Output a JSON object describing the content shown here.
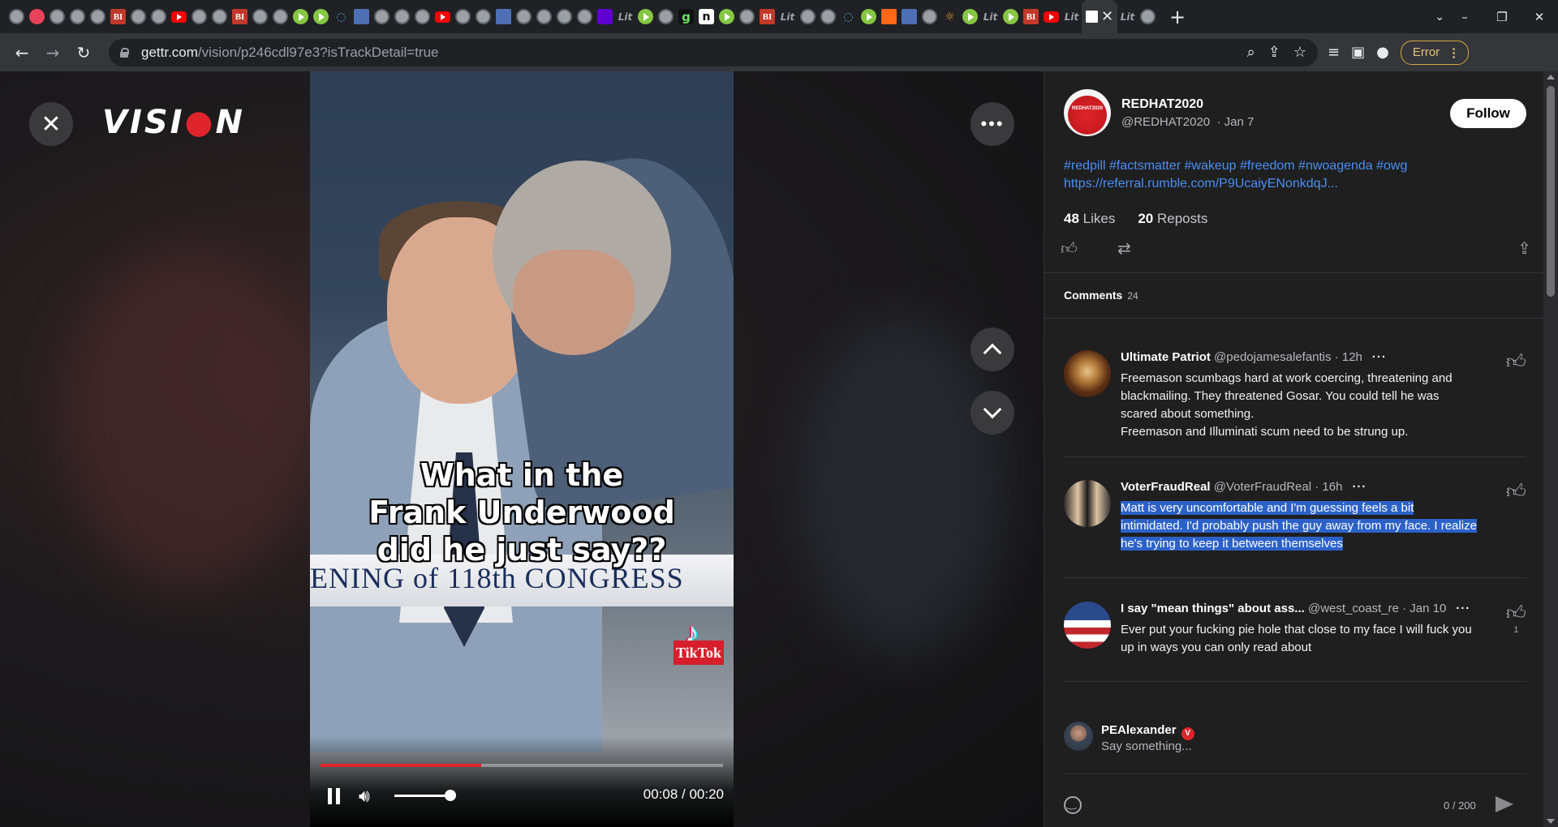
{
  "browser": {
    "url_domain": "gettr.com",
    "url_path": "/vision/p246cdl97e3?isTrackDetail=true",
    "error_label": "Error",
    "tab_favicons": [
      "globe",
      "multi",
      "globe",
      "globe",
      "globe",
      "bi",
      "globe",
      "globe",
      "yt",
      "globe",
      "globe",
      "bi",
      "globe",
      "globe",
      "rumble",
      "rumble",
      "shield",
      "flag",
      "globe",
      "globe",
      "globe",
      "yt",
      "globe",
      "globe",
      "flag",
      "globe",
      "globe",
      "globe",
      "globe",
      "yahoo",
      "lit",
      "rumble",
      "globe",
      "g",
      "n",
      "rumble",
      "globe",
      "bi",
      "lit",
      "globe",
      "globe",
      "shield",
      "rumble",
      "stack",
      "flag",
      "globe",
      "sun",
      "rumble",
      "lit",
      "rumble",
      "bi",
      "yt",
      "lit"
    ],
    "bi_letter": "BI",
    "lit_letter": "Lit",
    "g_letter": "g",
    "n_letter": "n"
  },
  "vision": {
    "logo_left": "VISI",
    "logo_dot": "●",
    "logo_right": "N",
    "video": {
      "caption_lines": [
        "What in the",
        "Frank Underwood",
        "did he just say??"
      ],
      "chyron": "ENING of 118th CONGRESS",
      "watermark": "TikTok",
      "time": "00:08 / 00:20",
      "progress_fraction": 0.4,
      "volume_fraction": 0.8
    }
  },
  "post": {
    "author_name": "REDHAT2020",
    "author_handle": "@REDHAT2020",
    "date": "· Jan 7",
    "follow_label": "Follow",
    "tags_line": "#redpill #factsmatter #wakeup #freedom #nwoagenda #owg",
    "link": "https://referral.rumble.com/P9UcaiyENonkdqJ...",
    "likes_count": "48",
    "likes_label": "Likes",
    "reposts_count": "20",
    "reposts_label": "Reposts",
    "avatar_text": "REDHAT2020"
  },
  "comments": {
    "title": "Comments",
    "count": "24",
    "items": [
      {
        "name": "Ultimate Patriot",
        "handle": "@pedojamesalefantis",
        "time": "· 12h",
        "text": "Freemason scumbags hard at work coercing, threatening and blackmailing. They threatened Gosar. You could tell he was scared about something.",
        "text2": "Freemason and Illuminati scum need to be strung up.",
        "likes": ""
      },
      {
        "name": "VoterFraudReal",
        "handle": "@VoterFraudReal",
        "time": "· 16h",
        "text": "Matt is very uncomfortable and I'm guessing feels a bit intimidated. I'd probably push the guy away from my face. I realize he's trying to keep it between themselves",
        "likes": ""
      },
      {
        "name": "I say \"mean things\" about ass...",
        "handle": "@west_coast_re",
        "time": "· Jan 10",
        "text": "Ever put your fucking pie hole that close to my face I will fuck you up in ways you can only read about",
        "likes": "1"
      }
    ]
  },
  "reply": {
    "user_name": "PEAlexander",
    "verified_mark": "V",
    "placeholder": "Say something...",
    "char_count": "0 / 200"
  }
}
